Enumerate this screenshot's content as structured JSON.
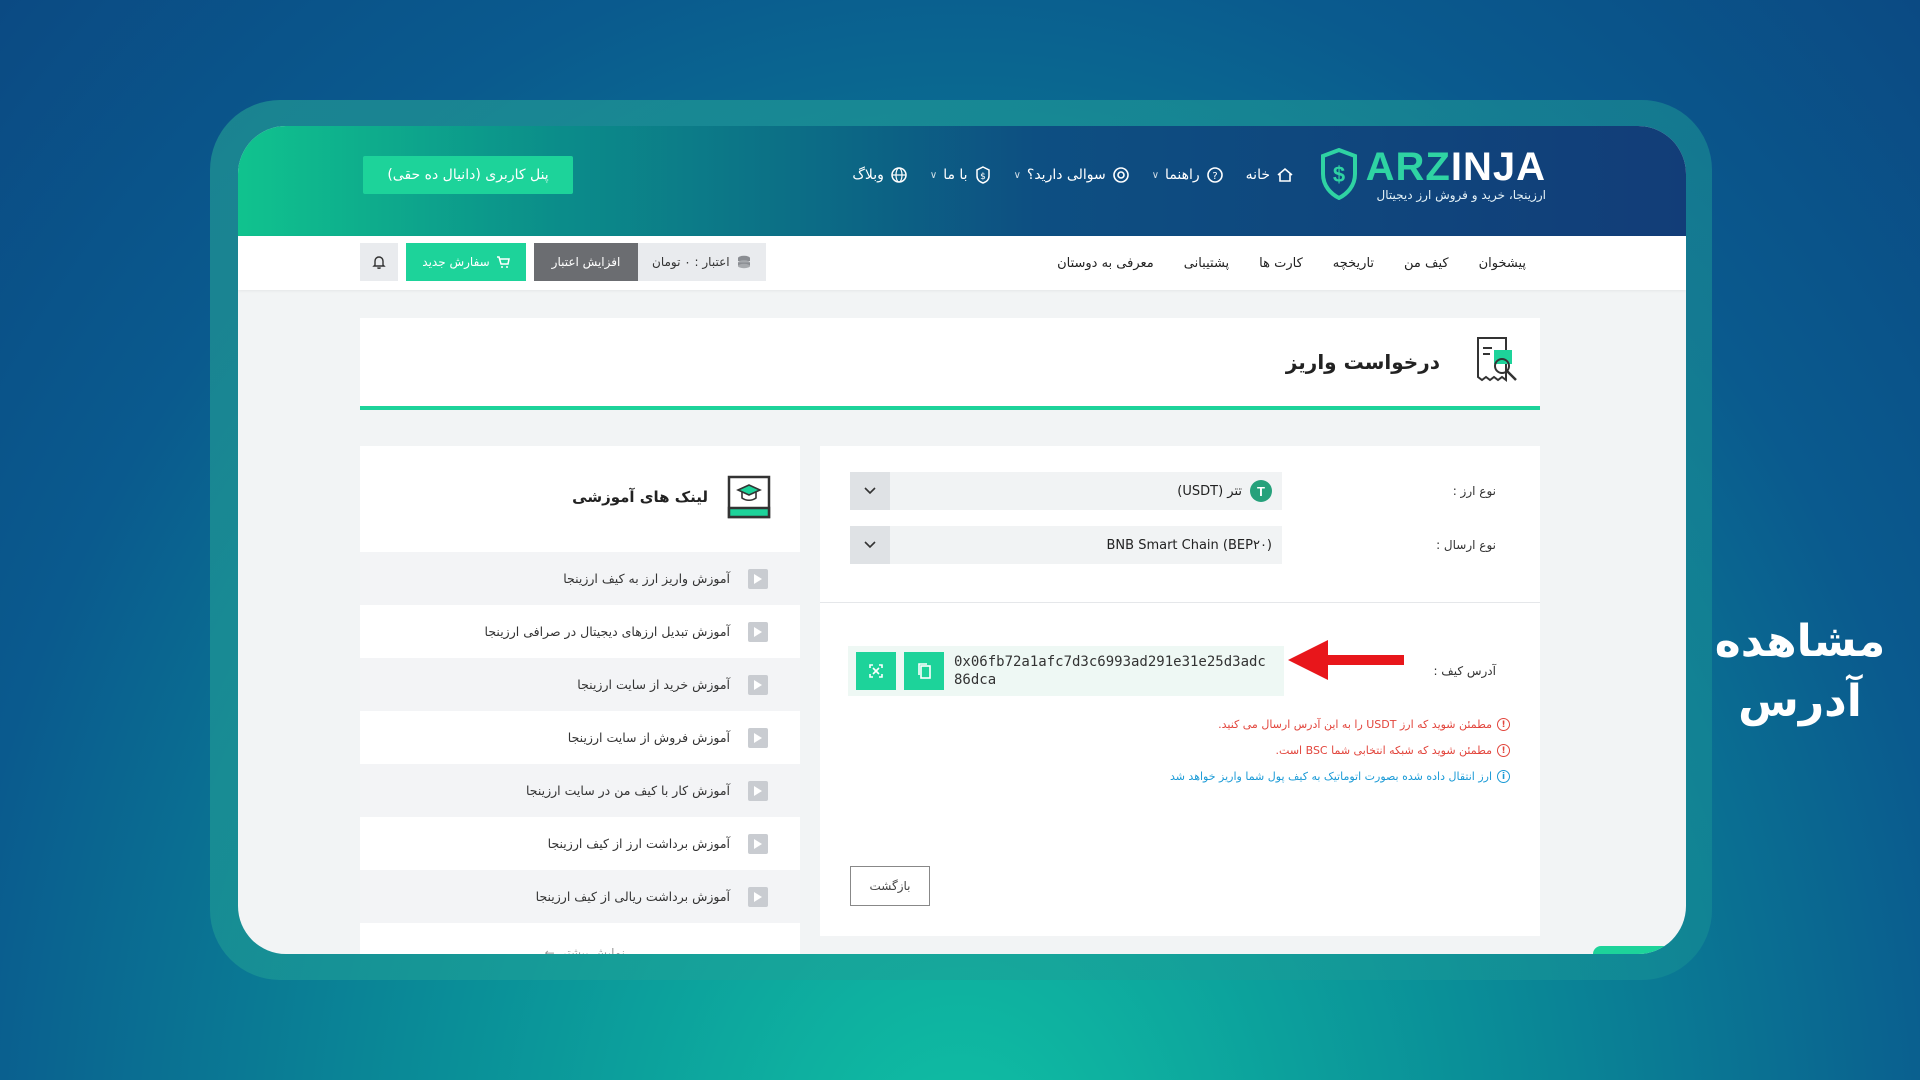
{
  "header": {
    "logo_word_a": "ARZ",
    "logo_word_b": "INJA",
    "logo_sub": "ارزینجا، خرید و فروش ارز دیجیتال",
    "nav": [
      {
        "label": "خانه",
        "icon": "home-icon"
      },
      {
        "label": "راهنما",
        "icon": "help-icon",
        "dropdown": true
      },
      {
        "label": "سوالی دارید؟",
        "icon": "lifebuoy-icon",
        "dropdown": true
      },
      {
        "label": "با ما",
        "icon": "coin-icon",
        "dropdown": true
      },
      {
        "label": "وبلاگ",
        "icon": "globe-icon"
      }
    ],
    "panel_button": "پنل کاربری (دانیال ده حقی)"
  },
  "subnav": {
    "items": [
      "پیشخوان",
      "کیف من",
      "تاریخچه",
      "کارت ها",
      "پشتیبانی",
      "معرفی به دوستان"
    ],
    "credit": "اعتبار : ۰ تومان",
    "increase_credit": "افزایش اعتبار",
    "new_order": "سفارش جدید"
  },
  "page": {
    "title": "درخواست واریز"
  },
  "form": {
    "currency_label": "نوع ارز :",
    "currency_value": "تتر (USDT)",
    "network_label": "نوع ارسال :",
    "network_value": "BNB Smart Chain (BEP۲۰)",
    "address_label": "آدرس کیف :",
    "address_value": "0x06fb72a1afc7d3c6993ad291e31e25d3adc86dca",
    "warnings": [
      {
        "text": "مطمئن شوید که ارز USDT را به این آدرس ارسال می کنید.",
        "color": "red"
      },
      {
        "text": "مطمئن شوید که شبکه انتخابی شما BSC است.",
        "color": "red"
      },
      {
        "text": "ارز انتقال داده شده بصورت اتوماتیک به کیف پول شما واریز خواهد شد",
        "color": "blue"
      }
    ],
    "back_button": "بازگشت"
  },
  "sidebar": {
    "title": "لینک های آموزشی",
    "links": [
      "آموزش واریز ارز به کیف ارزینجا",
      "آموزش تبدیل ارزهای دیجیتال در صرافی ارزینجا",
      "آموزش خرید از سایت ارزینجا",
      "آموزش فروش از سایت ارزینجا",
      "آموزش کار با کیف من در سایت ارزینجا",
      "آموزش برداشت ارز از کیف ارزینجا",
      "آموزش برداشت ریالی از کیف ارزینجا"
    ],
    "more": "نمایش بیشتر"
  },
  "caption": {
    "line1": "مشاهده",
    "line2": "آدرس"
  },
  "colors": {
    "accent": "#1dd39a",
    "arrow": "#e8161b",
    "header_dark": "#123d78"
  }
}
